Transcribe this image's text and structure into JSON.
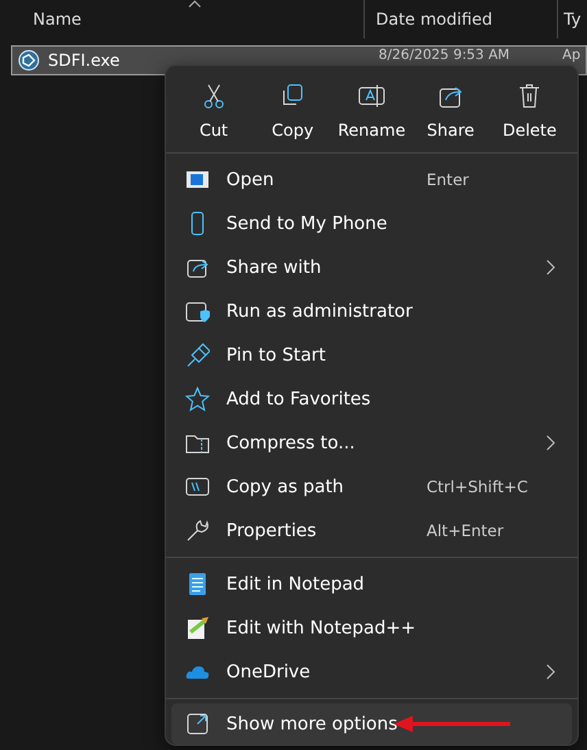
{
  "columns": [
    {
      "label": "Name"
    },
    {
      "label": "Date modified"
    },
    {
      "label": "Ty"
    }
  ],
  "file": {
    "name": "SDFI.exe",
    "date": "8/26/2025 9:53 AM",
    "type": "Ap",
    "selected": true
  },
  "menu": {
    "actions": [
      {
        "label": "Cut"
      },
      {
        "label": "Copy"
      },
      {
        "label": "Rename"
      },
      {
        "label": "Share"
      },
      {
        "label": "Delete"
      }
    ],
    "groups": [
      [
        {
          "label": "Open",
          "shortcut": "Enter",
          "submenu": false,
          "highlighted": false
        },
        {
          "label": "Send to My Phone",
          "submenu": false,
          "highlighted": false
        },
        {
          "label": "Share with",
          "submenu": true,
          "highlighted": false
        },
        {
          "label": "Run as administrator",
          "submenu": false,
          "highlighted": false
        },
        {
          "label": "Pin to Start",
          "submenu": false,
          "highlighted": false
        },
        {
          "label": "Add to Favorites",
          "submenu": false,
          "highlighted": false
        },
        {
          "label": "Compress to...",
          "submenu": true,
          "highlighted": false
        },
        {
          "label": "Copy as path",
          "shortcut": "Ctrl+Shift+C",
          "submenu": false,
          "highlighted": false
        },
        {
          "label": "Properties",
          "shortcut": "Alt+Enter",
          "submenu": false,
          "highlighted": false
        }
      ],
      [
        {
          "label": "Edit in Notepad",
          "submenu": false,
          "highlighted": false
        },
        {
          "label": "Edit with Notepad++",
          "submenu": false,
          "highlighted": false
        },
        {
          "label": "OneDrive",
          "submenu": true,
          "highlighted": false
        }
      ],
      [
        {
          "label": "Show more options",
          "submenu": false,
          "highlighted": true,
          "pointer": true
        }
      ]
    ]
  }
}
